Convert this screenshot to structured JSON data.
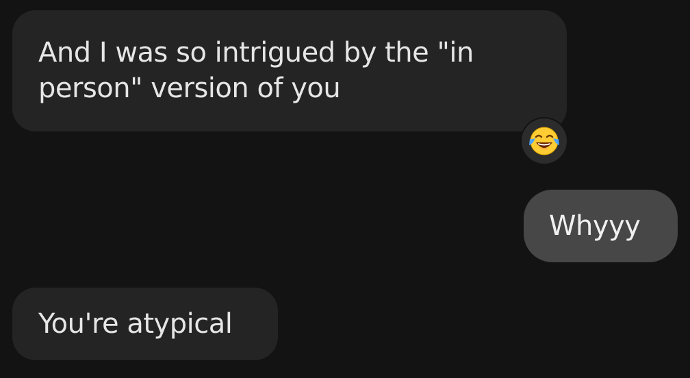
{
  "conversation": {
    "messages": [
      {
        "direction": "incoming",
        "text": "And I was so intrigued by the \"in person\" version of you",
        "reaction": "face-with-tears-of-joy-icon"
      },
      {
        "direction": "outgoing",
        "text": "Whyyy"
      },
      {
        "direction": "incoming",
        "text": "You're atypical"
      }
    ]
  },
  "colors": {
    "background": "#131313",
    "incoming_bubble": "#242424",
    "outgoing_bubble": "#474747",
    "text": "#e6e6e6"
  }
}
